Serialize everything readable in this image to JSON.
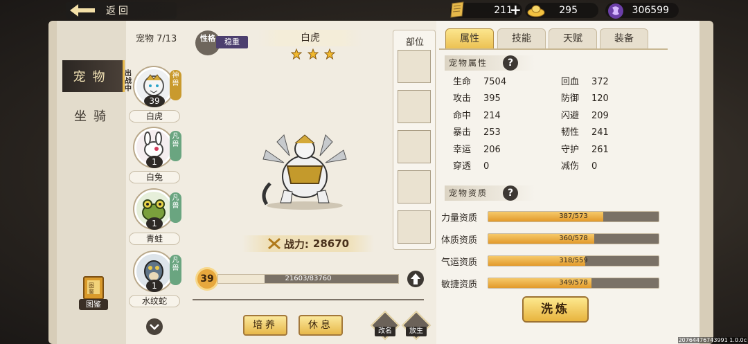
{
  "topbar": {
    "back_label": "返回",
    "scrolls": "211",
    "plus": "+",
    "gold": "295",
    "gems": "306599"
  },
  "sidebar": {
    "tabs": [
      {
        "label": "宠物",
        "active": true
      },
      {
        "label": "坐骑",
        "active": false
      }
    ],
    "book_label": "图鉴",
    "book_cover": "图鉴"
  },
  "pet_list": {
    "count": "宠物 7/13",
    "items": [
      {
        "name": "白虎",
        "level": "1",
        "tag": "神兽",
        "tag_color": "#c99a2e",
        "out": "出战中",
        "level_shown": "39"
      },
      {
        "name": "白兔",
        "level": "1",
        "tag": "凡兽",
        "tag_color": "#6aa580"
      },
      {
        "name": "青蛙",
        "level": "1",
        "tag": "凡兽",
        "tag_color": "#6aa580"
      },
      {
        "name": "水纹蛇",
        "level": "1",
        "tag": "凡兽",
        "tag_color": "#6aa580"
      }
    ]
  },
  "pet": {
    "personality_label": "性格",
    "personality": "稳重",
    "name": "白虎",
    "stars": 3,
    "power_label": "战力:",
    "power": "28670",
    "level": "39",
    "exp": "21603/83760",
    "exp_fraction": 0.258,
    "train_label": "培养",
    "rest_label": "休息",
    "rename_label": "改名",
    "release_label": "放生"
  },
  "parts": {
    "title": "部位"
  },
  "tabs": [
    {
      "label": "属性",
      "active": true
    },
    {
      "label": "技能",
      "active": false
    },
    {
      "label": "天赋",
      "active": false
    },
    {
      "label": "装备",
      "active": false
    }
  ],
  "attributes": {
    "title": "宠物属性",
    "stats": [
      {
        "k": "生命",
        "v": "7504"
      },
      {
        "k": "回血",
        "v": "372"
      },
      {
        "k": "攻击",
        "v": "395"
      },
      {
        "k": "防御",
        "v": "120"
      },
      {
        "k": "命中",
        "v": "214"
      },
      {
        "k": "闪避",
        "v": "209"
      },
      {
        "k": "暴击",
        "v": "253"
      },
      {
        "k": "韧性",
        "v": "241"
      },
      {
        "k": "幸运",
        "v": "206"
      },
      {
        "k": "守护",
        "v": "261"
      },
      {
        "k": "穿透",
        "v": "0"
      },
      {
        "k": "减伤",
        "v": "0"
      }
    ]
  },
  "aptitude": {
    "title": "宠物资质",
    "items": [
      {
        "label": "力量资质",
        "text": "387/573",
        "fraction": 0.675
      },
      {
        "label": "体质资质",
        "text": "360/578",
        "fraction": 0.623
      },
      {
        "label": "气运资质",
        "text": "318/559",
        "fraction": 0.569
      },
      {
        "label": "敏捷资质",
        "text": "349/578",
        "fraction": 0.604
      }
    ],
    "wash_label": "洗炼"
  },
  "build": "20764476743991 1.0.0c",
  "colors": {
    "accent": "#e8b43e",
    "dark": "#2d2926",
    "paper": "#f1ece1"
  }
}
